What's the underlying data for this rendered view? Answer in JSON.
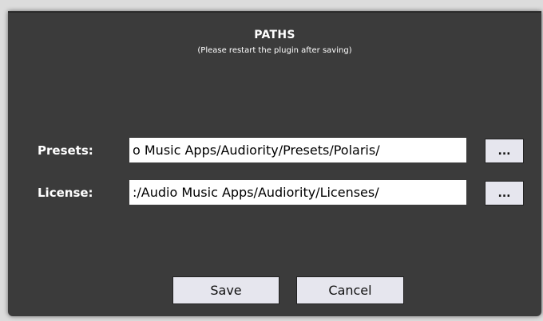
{
  "dialog": {
    "title": "PATHS",
    "subtitle": "(Please restart the plugin after saving)"
  },
  "paths": {
    "presets": {
      "label": "Presets:",
      "value": "o Music Apps/Audiority/Presets/Polaris/",
      "browse_label": "..."
    },
    "license": {
      "label": "License:",
      "value": ":/Audio Music Apps/Audiority/Licenses/",
      "browse_label": "..."
    }
  },
  "buttons": {
    "save_label": "Save",
    "cancel_label": "Cancel"
  },
  "colors": {
    "dialog_background": "#3b3b3b",
    "field_background": "#ffffff",
    "button_background": "#e6e6ee",
    "text_light": "#ffffff"
  }
}
